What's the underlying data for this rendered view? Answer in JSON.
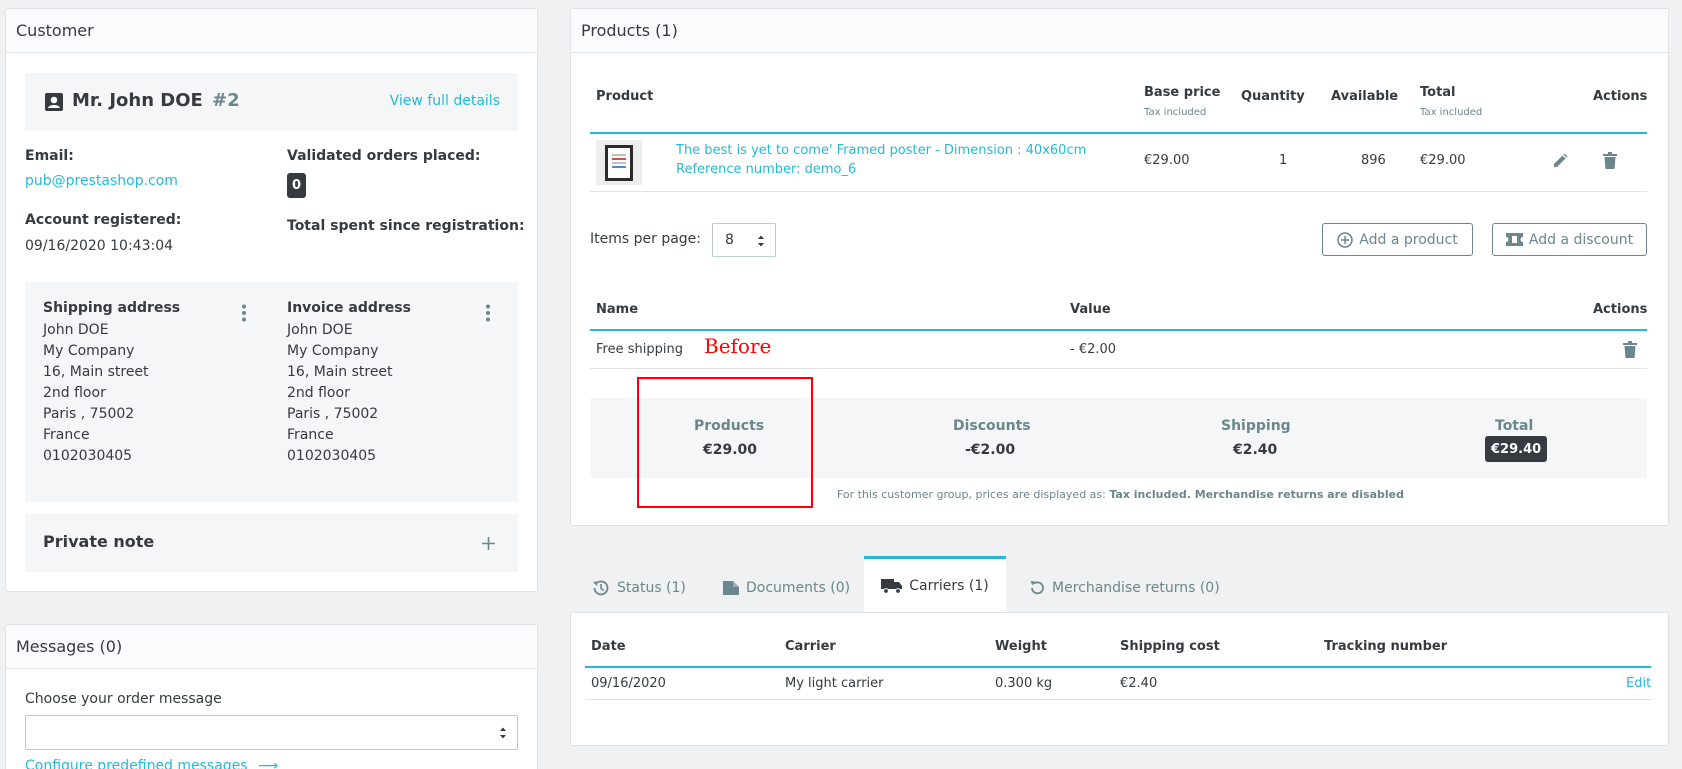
{
  "customer": {
    "header": "Customer",
    "name": "Mr. John DOE",
    "id": "#2",
    "view_details": "View full details",
    "email_label": "Email:",
    "email": "pub@prestashop.com",
    "orders_label": "Validated orders placed:",
    "orders_count": "0",
    "registered_label": "Account registered:",
    "registered": "09/16/2020 10:43:04",
    "spent_label": "Total spent since registration:",
    "shipping_address": {
      "title": "Shipping address",
      "lines": [
        "John DOE",
        "My Company",
        "16, Main street",
        "2nd floor",
        "Paris , 75002",
        "France",
        "0102030405"
      ]
    },
    "invoice_address": {
      "title": "Invoice address",
      "lines": [
        "John DOE",
        "My Company",
        "16, Main street",
        "2nd floor",
        "Paris , 75002",
        "France",
        "0102030405"
      ]
    },
    "private_note": "Private note"
  },
  "messages": {
    "header": "Messages (0)",
    "choose_label": "Choose your order message",
    "configure_link": "Configure predefined messages"
  },
  "products": {
    "header": "Products (1)",
    "columns": {
      "product": "Product",
      "base_price": "Base price",
      "base_price_sub": "Tax included",
      "quantity": "Quantity",
      "available": "Available",
      "total": "Total",
      "total_sub": "Tax included",
      "actions": "Actions"
    },
    "row": {
      "name": "The best is yet to come' Framed poster - Dimension : 40x60cm",
      "reference": "Reference number: demo_6",
      "base_price": "€29.00",
      "quantity": "1",
      "available": "896",
      "total": "€29.00"
    },
    "items_per_page_label": "Items per page:",
    "items_per_page_value": "8",
    "add_product": "Add a product",
    "add_discount": "Add a discount",
    "discount_columns": {
      "name": "Name",
      "value": "Value",
      "actions": "Actions"
    },
    "discount_row": {
      "name": "Free shipping",
      "value": "- €2.00"
    },
    "annotation": "Before",
    "summary": {
      "products_label": "Products",
      "products_value": "€29.00",
      "discounts_label": "Discounts",
      "discounts_value": "-€2.00",
      "shipping_label": "Shipping",
      "shipping_value": "€2.40",
      "total_label": "Total",
      "total_value": "€29.40"
    },
    "note_prefix": "For this customer group, prices are displayed as: ",
    "note_tax": "Tax included",
    "note_sep": ". ",
    "note_returns": "Merchandise returns are disabled"
  },
  "tabs": [
    {
      "label": "Status (1)"
    },
    {
      "label": "Documents (0)"
    },
    {
      "label": "Carriers (1)"
    },
    {
      "label": "Merchandise returns (0)"
    }
  ],
  "carriers": {
    "columns": {
      "date": "Date",
      "carrier": "Carrier",
      "weight": "Weight",
      "shipping_cost": "Shipping cost",
      "tracking": "Tracking number"
    },
    "row": {
      "date": "09/16/2020",
      "carrier": "My light carrier",
      "weight": "0.300 kg",
      "shipping_cost": "€2.40",
      "edit": "Edit"
    }
  },
  "colors": {
    "accent": "#25b9d7",
    "muted": "#6c868e",
    "annotation": "#ff0000"
  }
}
